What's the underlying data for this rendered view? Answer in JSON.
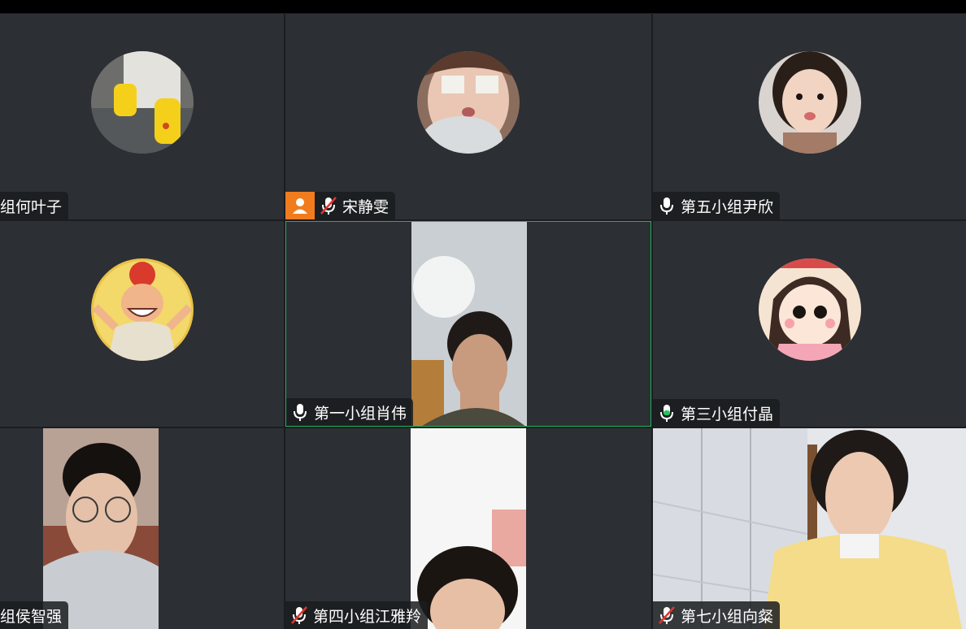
{
  "participants": [
    {
      "name": "组何叶子",
      "mic": "none"
    },
    {
      "name": "宋静雯",
      "mic": "muted",
      "host": true
    },
    {
      "name": "第五小组尹欣",
      "mic": "on"
    },
    {
      "name": "",
      "mic": "none"
    },
    {
      "name": "第一小组肖伟",
      "mic": "on",
      "speaking": true
    },
    {
      "name": "第三小组付晶",
      "mic": "on"
    },
    {
      "name": "组侯智强",
      "mic": "none"
    },
    {
      "name": "第四小组江雅羚",
      "mic": "muted"
    },
    {
      "name": "第七小组向粲",
      "mic": "muted"
    }
  ],
  "colors": {
    "tile_bg": "#2c2f33",
    "active_border": "#1fb35c",
    "host_badge": "#f07c1e"
  },
  "icons": [
    "microphone-icon",
    "microphone-muted-icon",
    "host-user-icon"
  ]
}
